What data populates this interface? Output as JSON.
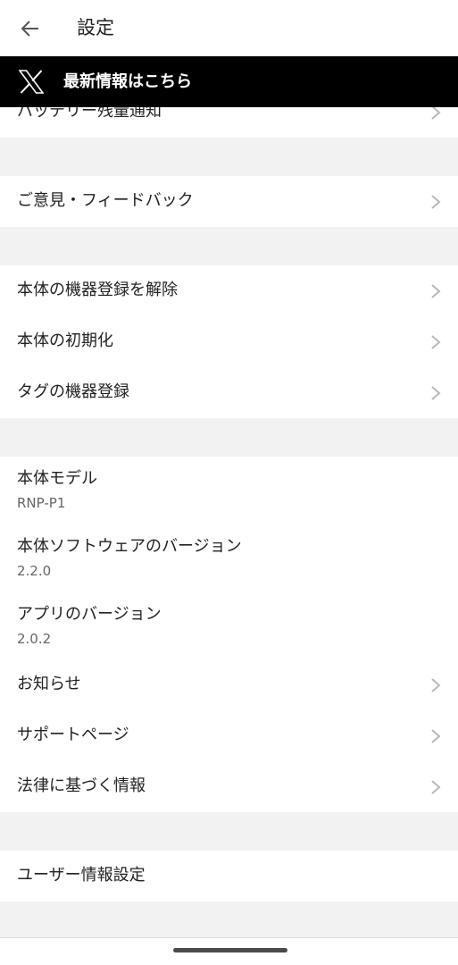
{
  "header": {
    "title": "設定"
  },
  "banner": {
    "text": "最新情報はこちら"
  },
  "sections": {
    "battery": {
      "label": "バッテリー残量通知"
    },
    "feedback": {
      "label": "ご意見・フィードバック"
    },
    "device": {
      "unregister": "本体の機器登録を解除",
      "reset": "本体の初期化",
      "tag_register": "タグの機器登録"
    },
    "info": {
      "model_label": "本体モデル",
      "model_value": "RNP-P1",
      "software_label": "本体ソフトウェアのバージョン",
      "software_value": "2.2.0",
      "app_label": "アプリのバージョン",
      "app_value": "2.0.2",
      "news": "お知らせ",
      "support": "サポートページ",
      "legal": "法律に基づく情報"
    },
    "user": {
      "label": "ユーザー情報設定"
    }
  },
  "icons": {
    "back": "arrow-left-icon",
    "x_logo": "x-logo-icon",
    "chevron": "chevron-right-icon"
  },
  "colors": {
    "background": "#f2f2f2",
    "banner": "#000000",
    "chevron": "#b8b8b8",
    "secondary_text": "#666666"
  }
}
